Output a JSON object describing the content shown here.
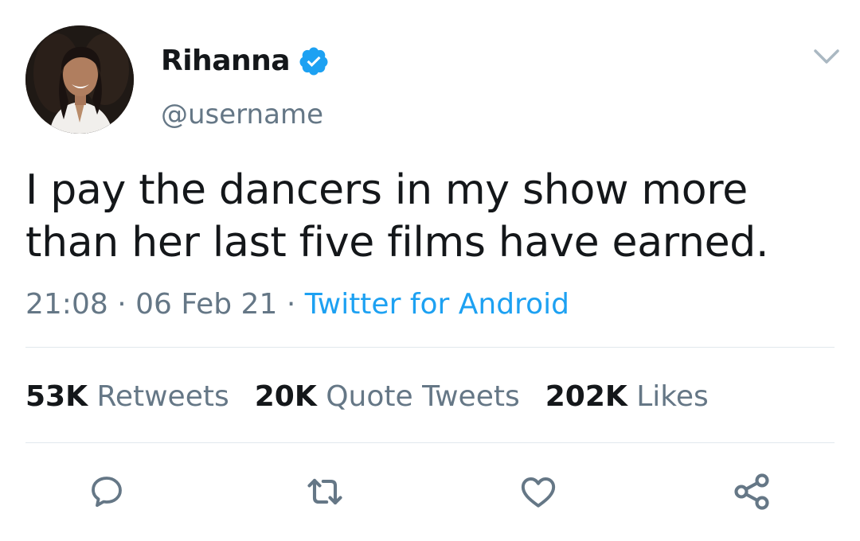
{
  "tweet": {
    "display_name": "Rihanna",
    "handle": "@username",
    "verified": true,
    "text": "I pay the dancers in my show more than her last five films have earned.",
    "time": "21:08",
    "separator": "·",
    "date": "06 Feb 21",
    "source": "Twitter for Android"
  },
  "stats": {
    "retweets_count": "53K",
    "retweets_label": "Retweets",
    "quotes_count": "20K",
    "quotes_label": "Quote Tweets",
    "likes_count": "202K",
    "likes_label": "Likes"
  },
  "actions": [
    "reply-icon",
    "retweet-icon",
    "like-icon",
    "share-icon"
  ],
  "colors": {
    "accent": "#1da1f2",
    "text": "#14171a",
    "secondary": "#657786",
    "divider": "#e1e8ed"
  }
}
